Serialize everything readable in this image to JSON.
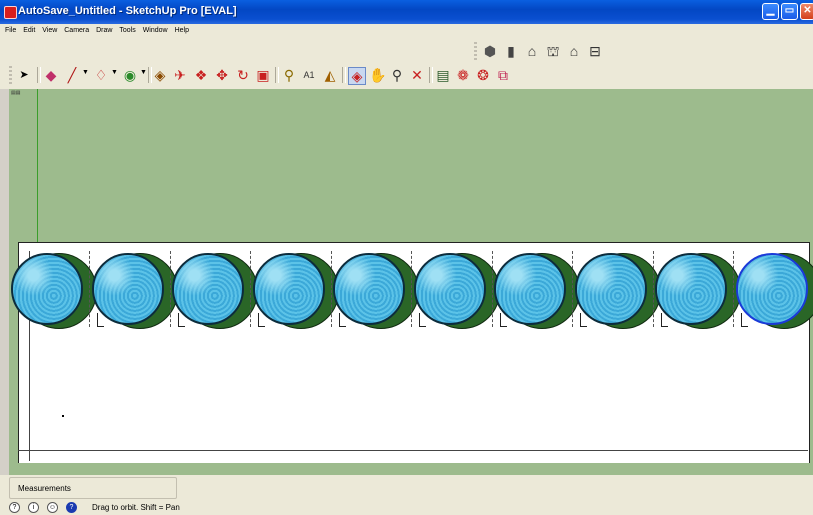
{
  "window": {
    "title": "AutoSave_Untitled - SketchUp Pro [EVAL]",
    "min_glyph": "▁",
    "max_glyph": "▭",
    "close_glyph": "✕"
  },
  "menu": [
    "File",
    "Edit",
    "View",
    "Camera",
    "Draw",
    "Tools",
    "Window",
    "Help"
  ],
  "views_toolbar": [
    "iso-view-icon",
    "top-view-icon",
    "front-view-icon",
    "right-view-icon",
    "back-view-icon",
    "left-view-icon"
  ],
  "main_toolbar": [
    "select-arrow-icon",
    "eraser-icon",
    "line-pencil-icon",
    "arc-icon",
    "circle-icon",
    "push-pull-icon",
    "follow-me-icon",
    "move-icon",
    "rotate-icon",
    "scale-icon",
    "tape-measure-icon",
    "text-label-icon",
    "paint-bucket-icon",
    "orbit-icon",
    "pan-icon",
    "zoom-icon",
    "zoom-extents-icon",
    "warehouse-icon",
    "components-icon",
    "extension-icon",
    "share-model-icon"
  ],
  "scene": {
    "pool_count": 10,
    "selected_pool_index": 9
  },
  "measurements_label": "Measurements",
  "status_text": "Drag to orbit.  Shift = Pan",
  "colors": {
    "viewport": "#9dbb8d",
    "pool_water": "#46b3e0",
    "pool_shadow": "#2a6627",
    "title_bar": "#0347c4"
  }
}
